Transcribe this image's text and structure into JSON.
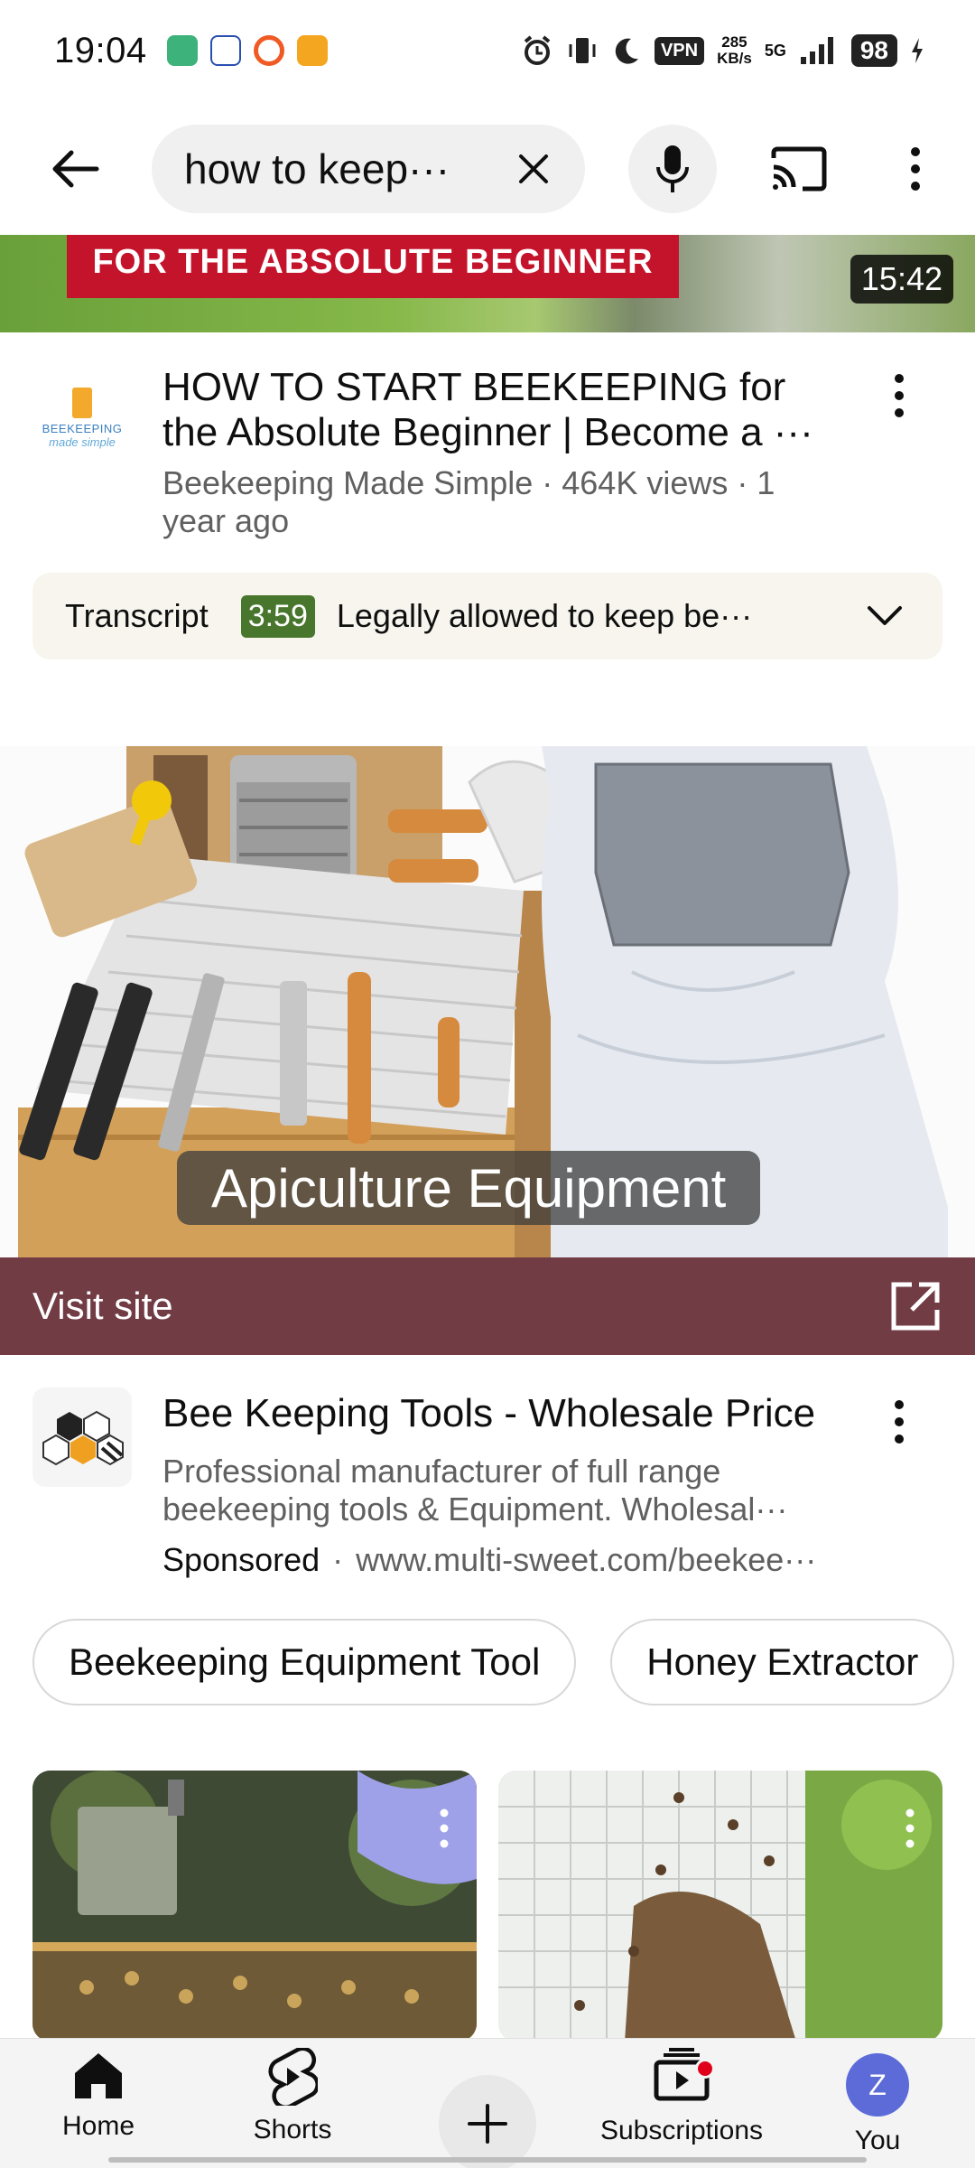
{
  "status_bar": {
    "time": "19:04",
    "network_speed": "285",
    "network_speed_unit": "KB/s",
    "vpn": "VPN",
    "network_type": "5G",
    "battery": "98"
  },
  "search": {
    "query": "how to keep···"
  },
  "top_video": {
    "banner_text": "FOR THE ABSOLUTE BEGINNER",
    "duration": "15:42",
    "channel_avatar_text": "BEEKEEPING",
    "channel_avatar_sub": "made simple",
    "title": "HOW TO START BEEKEEPING for the Absolute Beginner | Become a ···",
    "meta": "Beekeeping Made Simple · 464K views · 1 year ago"
  },
  "transcript": {
    "label": "Transcript",
    "timestamp": "3:59",
    "text": "Legally allowed to keep be···"
  },
  "ad": {
    "image_caption": "Apiculture Equipment",
    "visit_label": "Visit site",
    "title": "Bee Keeping Tools - Wholesale Price",
    "description": "Professional manufacturer of full range beekeeping tools & Equipment. Wholesal···",
    "sponsored": "Sponsored",
    "url": "www.multi-sweet.com/beekee···",
    "chips": [
      "Beekeeping Equipment Tool",
      "Honey Extractor"
    ]
  },
  "bottom_nav": {
    "home": "Home",
    "shorts": "Shorts",
    "subscriptions": "Subscriptions",
    "you": "You",
    "you_avatar_letter": "Z"
  },
  "colors": {
    "visit_bar": "#723c45",
    "transcript_time": "#47762c",
    "thumb_banner": "#c4142c",
    "you_avatar": "#5c6bd8",
    "notification_dot": "#e0001a"
  }
}
